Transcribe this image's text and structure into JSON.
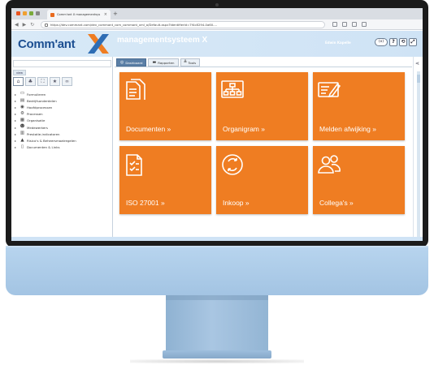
{
  "browser": {
    "tab_title": "Comm'ant X managementsys",
    "tab_close": "×",
    "new_tab": "+",
    "url": "https://dev.commant.com/dev_commant_com_commant_xml_a/Default.aspx?IdentifierId=7f4c8294-0a60-..."
  },
  "app": {
    "logo_text": "Comm'ant",
    "title": "managementsysteem X",
    "user_name": "Edwin Kapelle",
    "header_buttons": [
      "(x)",
      "?",
      "⟲",
      "⤢"
    ],
    "accent_color": "#ef7d22",
    "brand_color": "#1c4f92"
  },
  "sidebar": {
    "tab_label": "view",
    "icon_buttons": [
      "home-icon",
      "sitemap-icon",
      "expand-icon",
      "star-icon",
      "link-icon"
    ],
    "icon_glyphs": [
      "⌂",
      "♣",
      "⛶",
      "★",
      "∞"
    ],
    "items": [
      {
        "icon": "▭",
        "label": "Formulieren"
      },
      {
        "icon": "▤",
        "label": "Bedrijfsonderdelen"
      },
      {
        "icon": "◉",
        "label": "Hoofdprocessen"
      },
      {
        "icon": "⚙",
        "label": "Processen"
      },
      {
        "icon": "▦",
        "label": "Organisatie"
      },
      {
        "icon": "☻",
        "label": "Medewerkers"
      },
      {
        "icon": "▥",
        "label": "Prestatie-indicatoren"
      },
      {
        "icon": "▲",
        "label": "Risico's & Beheersmaatregelen"
      },
      {
        "icon": "▯",
        "label": "Documenten & Links"
      }
    ],
    "footer_left": "«",
    "footer_right": "⚙"
  },
  "content_tabs": [
    {
      "icon": "◎",
      "label": "Dashboard",
      "active": true
    },
    {
      "icon": "▬",
      "label": "Rapporten",
      "active": false
    },
    {
      "icon": "╩",
      "label": "Tools",
      "active": false
    }
  ],
  "tiles": [
    {
      "icon": "documents-icon",
      "label": "Documenten »"
    },
    {
      "icon": "org-chart-icon",
      "label": "Organigram »"
    },
    {
      "icon": "report-form-icon",
      "label": "Melden afwijking »"
    },
    {
      "icon": "checklist-icon",
      "label": "ISO 27001 »"
    },
    {
      "icon": "cycle-icon",
      "label": "Inkoop »"
    },
    {
      "icon": "colleagues-icon",
      "label": "Collega's »"
    }
  ],
  "rail": {
    "share_icon": "⋖"
  }
}
